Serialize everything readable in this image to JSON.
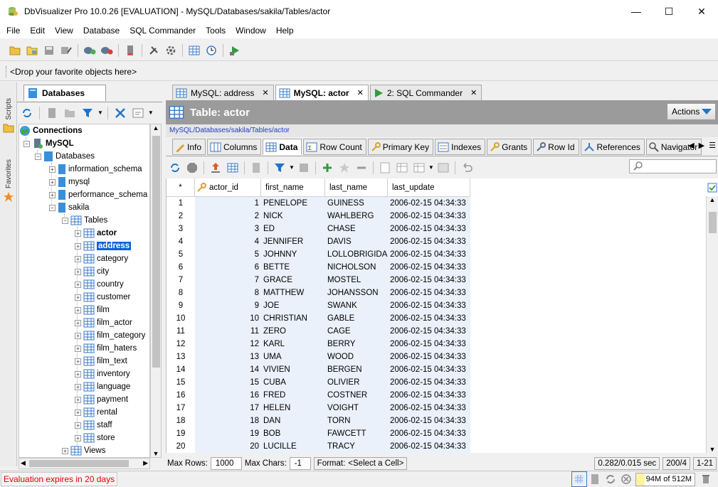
{
  "window": {
    "title": "DbVisualizer Pro 10.0.26 [EVALUATION] - MySQL/Databases/sakila/Tables/actor",
    "minimize": "—",
    "maximize": "☐",
    "close": "✕"
  },
  "menu": [
    "File",
    "Edit",
    "View",
    "Database",
    "SQL Commander",
    "Tools",
    "Window",
    "Help"
  ],
  "favorites_bar": {
    "text": "<Drop your favorite objects here>"
  },
  "side_strip": {
    "scripts": "Scripts",
    "favorites": "Favorites"
  },
  "left_panel": {
    "tab_label": "Databases",
    "tree": {
      "connections": "Connections",
      "mysql": "MySQL",
      "databases": "Databases",
      "schemas": [
        "information_schema",
        "mysql",
        "performance_schema"
      ],
      "sakila": "sakila",
      "tables_label": "Tables",
      "tables": [
        "actor",
        "address",
        "category",
        "city",
        "country",
        "customer",
        "film",
        "film_actor",
        "film_category",
        "film_haters",
        "film_text",
        "inventory",
        "language",
        "payment",
        "rental",
        "staff",
        "store"
      ],
      "views_label": "Views"
    }
  },
  "doc_tabs": [
    {
      "label": "MySQL: address"
    },
    {
      "label": "MySQL: actor"
    },
    {
      "label": "2: SQL Commander"
    }
  ],
  "object": {
    "title": "Table: actor",
    "path": "MySQL/Databases/sakila/Tables/actor",
    "actions_label": "Actions"
  },
  "sub_tabs": [
    "Info",
    "Columns",
    "Data",
    "Row Count",
    "Primary Key",
    "Indexes",
    "Grants",
    "Row Id",
    "References",
    "Navigator"
  ],
  "grid": {
    "corner": "*",
    "columns": [
      "actor_id",
      "first_name",
      "last_name",
      "last_update"
    ],
    "rows": [
      [
        "1",
        "1",
        "PENELOPE",
        "GUINESS",
        "2006-02-15 04:34:33"
      ],
      [
        "2",
        "2",
        "NICK",
        "WAHLBERG",
        "2006-02-15 04:34:33"
      ],
      [
        "3",
        "3",
        "ED",
        "CHASE",
        "2006-02-15 04:34:33"
      ],
      [
        "4",
        "4",
        "JENNIFER",
        "DAVIS",
        "2006-02-15 04:34:33"
      ],
      [
        "5",
        "5",
        "JOHNNY",
        "LOLLOBRIGIDA",
        "2006-02-15 04:34:33"
      ],
      [
        "6",
        "6",
        "BETTE",
        "NICHOLSON",
        "2006-02-15 04:34:33"
      ],
      [
        "7",
        "7",
        "GRACE",
        "MOSTEL",
        "2006-02-15 04:34:33"
      ],
      [
        "8",
        "8",
        "MATTHEW",
        "JOHANSSON",
        "2006-02-15 04:34:33"
      ],
      [
        "9",
        "9",
        "JOE",
        "SWANK",
        "2006-02-15 04:34:33"
      ],
      [
        "10",
        "10",
        "CHRISTIAN",
        "GABLE",
        "2006-02-15 04:34:33"
      ],
      [
        "11",
        "11",
        "ZERO",
        "CAGE",
        "2006-02-15 04:34:33"
      ],
      [
        "12",
        "12",
        "KARL",
        "BERRY",
        "2006-02-15 04:34:33"
      ],
      [
        "13",
        "13",
        "UMA",
        "WOOD",
        "2006-02-15 04:34:33"
      ],
      [
        "14",
        "14",
        "VIVIEN",
        "BERGEN",
        "2006-02-15 04:34:33"
      ],
      [
        "15",
        "15",
        "CUBA",
        "OLIVIER",
        "2006-02-15 04:34:33"
      ],
      [
        "16",
        "16",
        "FRED",
        "COSTNER",
        "2006-02-15 04:34:33"
      ],
      [
        "17",
        "17",
        "HELEN",
        "VOIGHT",
        "2006-02-15 04:34:33"
      ],
      [
        "18",
        "18",
        "DAN",
        "TORN",
        "2006-02-15 04:34:33"
      ],
      [
        "19",
        "19",
        "BOB",
        "FAWCETT",
        "2006-02-15 04:34:33"
      ],
      [
        "20",
        "20",
        "LUCILLE",
        "TRACY",
        "2006-02-15 04:34:33"
      ]
    ]
  },
  "grid_status": {
    "max_rows_label": "Max Rows:",
    "max_rows_value": "1000",
    "max_chars_label": "Max Chars:",
    "max_chars_value": "-1",
    "format_label": "Format:",
    "format_value": "<Select a Cell>",
    "timing": "0.282/0.015 sec",
    "rows_info": "200/4",
    "range": "1-21"
  },
  "status": {
    "evaluation": "Evaluation expires in 20 days",
    "memory": "94M of 512M"
  },
  "colors": {
    "selection": "#0a64d8",
    "header_gray": "#9b9b9b",
    "path_link": "#1c3fbf",
    "cell_bg": "#eaf1fb",
    "eval_red": "#dd0000"
  }
}
